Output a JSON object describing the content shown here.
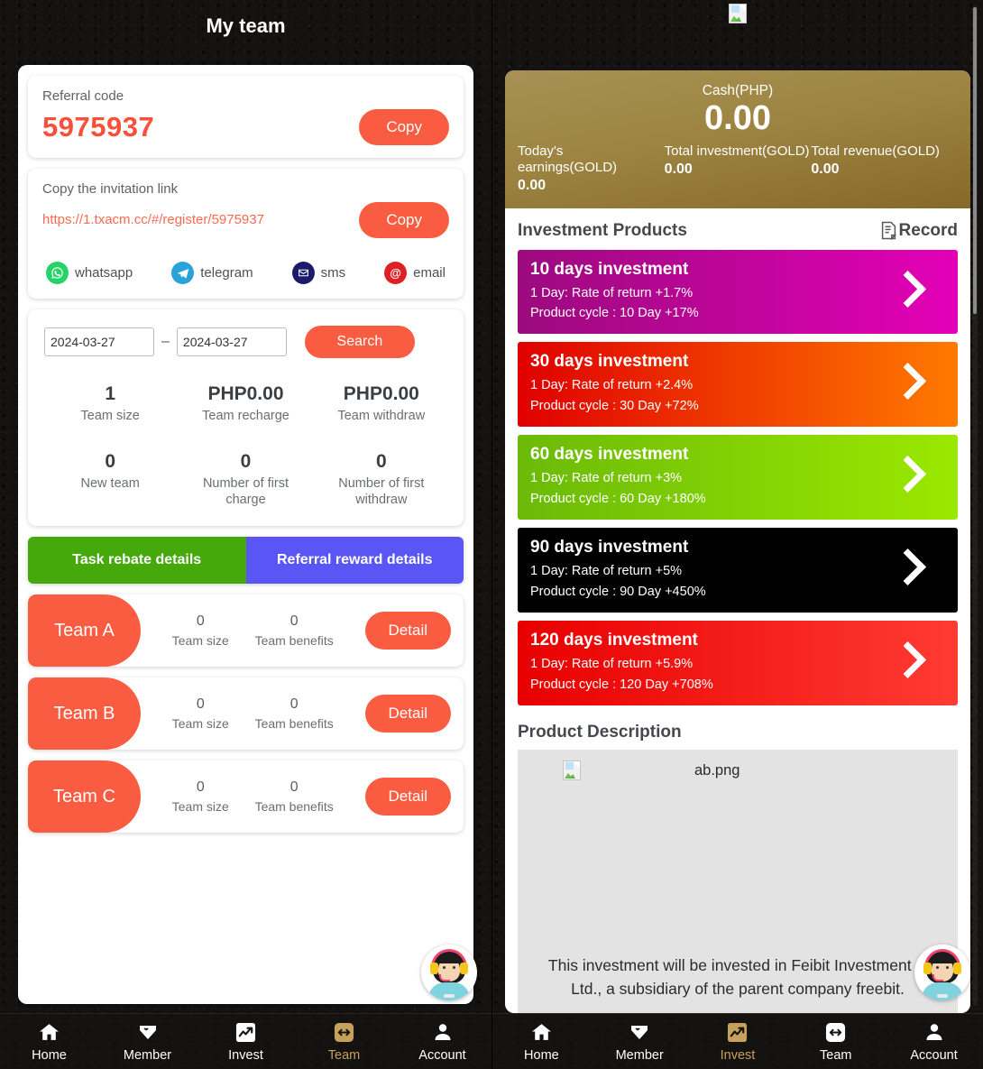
{
  "left": {
    "title": "My team",
    "referral": {
      "label": "Referral code",
      "code": "5975937",
      "copy_label": "Copy"
    },
    "invitation": {
      "label": "Copy the invitation link",
      "url": "https://1.txacm.cc/#/register/5975937",
      "copy_label": "Copy"
    },
    "share": [
      {
        "name": "whatsapp",
        "glyph": "✆",
        "icon": "whatsapp-icon"
      },
      {
        "name": "telegram",
        "glyph": "➤",
        "icon": "telegram-icon"
      },
      {
        "name": "sms",
        "glyph": "✉",
        "icon": "sms-icon"
      },
      {
        "name": "email",
        "glyph": "@",
        "icon": "email-icon"
      }
    ],
    "search": {
      "date_from": "2024-03-27",
      "date_to": "2024-03-27",
      "separator": "–",
      "button_label": "Search"
    },
    "stats_row1": [
      {
        "value": "1",
        "caption": "Team size"
      },
      {
        "value": "PHP0.00",
        "caption": "Team recharge"
      },
      {
        "value": "PHP0.00",
        "caption": "Team withdraw"
      }
    ],
    "stats_row2": [
      {
        "value": "0",
        "caption": "New team"
      },
      {
        "value": "0",
        "caption": "Number of first charge"
      },
      {
        "value": "0",
        "caption": "Number of first withdraw"
      }
    ],
    "tabs": {
      "task_rebate": "Task rebate details",
      "referral_reward": "Referral reward details"
    },
    "teams": [
      {
        "name": "Team A",
        "size": "0",
        "size_caption": "Team size",
        "benefits": "0",
        "benefits_caption": "Team benefits",
        "detail_label": "Detail"
      },
      {
        "name": "Team B",
        "size": "0",
        "size_caption": "Team size",
        "benefits": "0",
        "benefits_caption": "Team benefits",
        "detail_label": "Detail"
      },
      {
        "name": "Team C",
        "size": "0",
        "size_caption": "Team size",
        "benefits": "0",
        "benefits_caption": "Team benefits",
        "detail_label": "Detail"
      }
    ],
    "nav": [
      {
        "label": "Home",
        "icon": "home-icon",
        "active": false
      },
      {
        "label": "Member",
        "icon": "diamond-heart-icon",
        "active": false
      },
      {
        "label": "Invest",
        "icon": "chart-trend-icon",
        "active": false
      },
      {
        "label": "Team",
        "icon": "exchange-arrows-icon",
        "active": true
      },
      {
        "label": "Account",
        "icon": "person-icon",
        "active": false
      }
    ]
  },
  "right": {
    "top_image_alt": "broken-image",
    "balance": {
      "label": "Cash(PHP)",
      "amount": "0.00",
      "columns": [
        {
          "title": "Today's earnings(GOLD)",
          "value": "0.00"
        },
        {
          "title": "Total investment(GOLD)",
          "value": "0.00"
        },
        {
          "title": "Total revenue(GOLD)",
          "value": "0.00"
        }
      ]
    },
    "section": {
      "title": "Investment Products",
      "record_label": "Record"
    },
    "products": [
      {
        "title": "10 days investment",
        "rate_line": "1 Day: Rate of return +1.7%",
        "cycle_line": "Product cycle : 10 Day +17%",
        "theme": "p10"
      },
      {
        "title": "30 days investment",
        "rate_line": "1 Day: Rate of return +2.4%",
        "cycle_line": "Product cycle : 30 Day +72%",
        "theme": "p30"
      },
      {
        "title": "60 days investment",
        "rate_line": "1 Day: Rate of return +3%",
        "cycle_line": "Product cycle : 60 Day +180%",
        "theme": "p60"
      },
      {
        "title": "90 days investment",
        "rate_line": "1 Day: Rate of return +5%",
        "cycle_line": "Product cycle : 90 Day +450%",
        "theme": "p90"
      },
      {
        "title": "120 days investment",
        "rate_line": "1 Day: Rate of return +5.9%",
        "cycle_line": "Product cycle : 120 Day +708%",
        "theme": "p120"
      }
    ],
    "description": {
      "heading": "Product Description",
      "image_name": "ab.png",
      "text_line1": "This investment will be invested in Feibit Investment C",
      "text_line2": "Ltd., a subsidiary of the parent company freebit."
    },
    "nav": [
      {
        "label": "Home",
        "icon": "home-icon",
        "active": false
      },
      {
        "label": "Member",
        "icon": "diamond-heart-icon",
        "active": false
      },
      {
        "label": "Invest",
        "icon": "chart-trend-icon",
        "active": true
      },
      {
        "label": "Team",
        "icon": "exchange-arrows-icon",
        "active": false
      },
      {
        "label": "Account",
        "icon": "person-icon",
        "active": false
      }
    ]
  }
}
